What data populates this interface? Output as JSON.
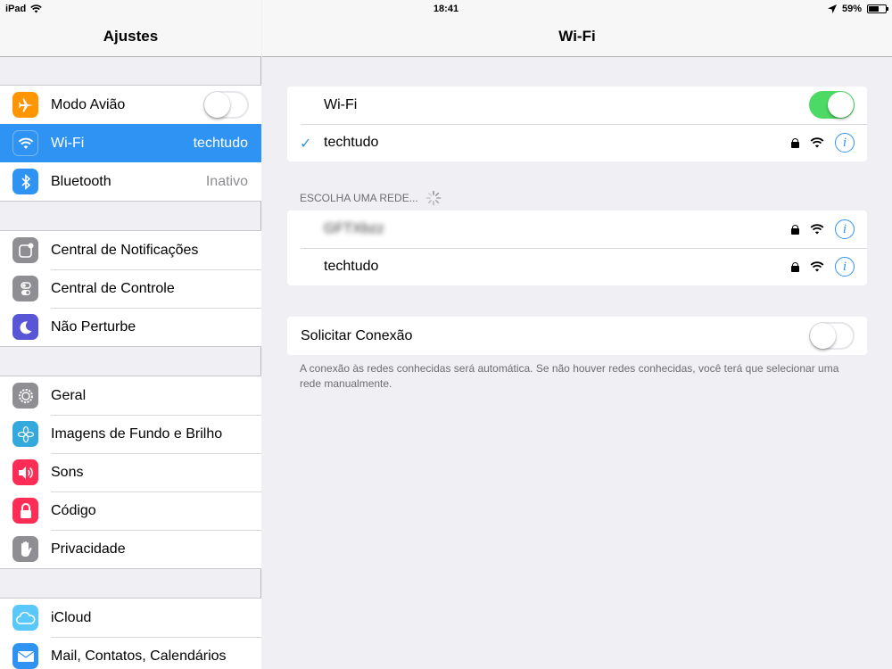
{
  "status_bar": {
    "device": "iPad",
    "time": "18:41",
    "battery_percent": "59%",
    "battery_level": 0.59
  },
  "sidebar": {
    "title": "Ajustes",
    "groups": [
      {
        "items": [
          {
            "label": "Modo Avião",
            "icon": "airplane-icon",
            "color": "#ff9500",
            "toggle": false
          },
          {
            "label": "Wi-Fi",
            "icon": "wifi-icon",
            "color": "#2f93f3",
            "value": "techtudo",
            "selected": true
          },
          {
            "label": "Bluetooth",
            "icon": "bluetooth-icon",
            "color": "#2f93f3",
            "value": "Inativo"
          }
        ]
      },
      {
        "items": [
          {
            "label": "Central de Notificações",
            "icon": "notifications-icon",
            "color": "#8e8e93"
          },
          {
            "label": "Central de Controle",
            "icon": "control-center-icon",
            "color": "#8e8e93"
          },
          {
            "label": "Não Perturbe",
            "icon": "moon-icon",
            "color": "#5856d6"
          }
        ]
      },
      {
        "items": [
          {
            "label": "Geral",
            "icon": "gear-icon",
            "color": "#8e8e93"
          },
          {
            "label": "Imagens de Fundo e Brilho",
            "icon": "wallpaper-icon",
            "color": "#34aadc"
          },
          {
            "label": "Sons",
            "icon": "speaker-icon",
            "color": "#ff2d55"
          },
          {
            "label": "Código",
            "icon": "lock-icon",
            "color": "#ff2d55"
          },
          {
            "label": "Privacidade",
            "icon": "hand-icon",
            "color": "#8e8e93"
          }
        ]
      },
      {
        "items": [
          {
            "label": "iCloud",
            "icon": "cloud-icon",
            "color": "#5ac8fa"
          },
          {
            "label": "Mail, Contatos, Calendários",
            "icon": "mail-icon",
            "color": "#2f93f3"
          }
        ]
      }
    ]
  },
  "main": {
    "title": "Wi-Fi",
    "wifi_toggle_label": "Wi-Fi",
    "wifi_enabled": true,
    "connected_network": "techtudo",
    "choose_network_header": "ESCOLHA UMA REDE...",
    "networks": [
      {
        "name": "GFTXbzz",
        "blurred": true,
        "secured": true
      },
      {
        "name": "techtudo",
        "blurred": false,
        "secured": true
      }
    ],
    "ask_to_join_label": "Solicitar Conexão",
    "ask_to_join_enabled": false,
    "ask_to_join_note": "A conexão às redes conhecidas será automática. Se não houver redes conhecidas, você terá que selecionar uma rede manualmente.",
    "info_glyph": "i",
    "checkmark_glyph": "✓"
  }
}
